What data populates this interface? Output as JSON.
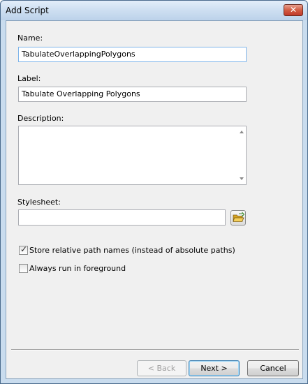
{
  "window": {
    "title": "Add Script",
    "close_glyph": "✕"
  },
  "form": {
    "name_label": "Name:",
    "name_value": "TabulateOverlappingPolygons",
    "label_label": "Label:",
    "label_value": "Tabulate Overlapping Polygons",
    "description_label": "Description:",
    "description_value": "",
    "stylesheet_label": "Stylesheet:",
    "stylesheet_value": ""
  },
  "options": {
    "store_relative": {
      "label": "Store relative path names (instead of absolute paths)",
      "checked": true
    },
    "always_foreground": {
      "label": "Always run in foreground",
      "checked": false
    }
  },
  "buttons": {
    "back": "< Back",
    "next": "Next >",
    "cancel": "Cancel"
  },
  "colors": {
    "titlebar": "#cfe0f2",
    "close": "#c0392b",
    "dialog_bg": "#f0f0f0",
    "focus_border": "#7eb4ea"
  }
}
